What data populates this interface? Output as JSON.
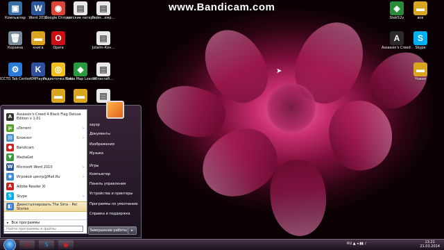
{
  "watermark": "www.Bandicam.com",
  "desktop_icons": [
    {
      "label": "Компьютер",
      "icon": "computer-icon",
      "color": "#3a6ea5",
      "glyph": "▣"
    },
    {
      "label": "Word 2010",
      "icon": "word-icon",
      "color": "#2b579a",
      "glyph": "W"
    },
    {
      "label": "Google Chrome",
      "icon": "chrome-icon",
      "color": "#db4437",
      "glyph": "◉"
    },
    {
      "label": "детские лагеря",
      "icon": "document-icon",
      "color": "#e8e8e8",
      "glyph": "▤"
    },
    {
      "label": "Гейм...емр...",
      "icon": "document-icon",
      "color": "#e8e8e8",
      "glyph": "▤"
    },
    {
      "label": "Корзина",
      "icon": "recycle-bin-icon",
      "color": "#7a8a9a",
      "glyph": "🗑"
    },
    {
      "label": "книга",
      "icon": "folder-icon",
      "color": "#d9a520",
      "glyph": "▬"
    },
    {
      "label": "Opera",
      "icon": "opera-icon",
      "color": "#cc0f16",
      "glyph": "O"
    },
    {
      "label": "Jotaim-Кон...",
      "icon": "document-icon",
      "color": "#e8e8e8",
      "glyph": "▤"
    },
    {
      "label": "ICCTO Tab Center",
      "icon": "tool-icon",
      "color": "#2a7ad8",
      "glyph": "⚙"
    },
    {
      "label": "KMPlayer",
      "icon": "kmplayer-icon",
      "color": "#3050a0",
      "glyph": "K"
    },
    {
      "label": "Радиоточка Плюс",
      "icon": "radio-icon",
      "color": "#f0c020",
      "glyph": "◎"
    },
    {
      "label": "Nokia Map Loader",
      "icon": "map-icon",
      "color": "#2a9a40",
      "glyph": "◆"
    },
    {
      "label": "Minecraft...",
      "icon": "document-icon",
      "color": "#e8e8e8",
      "glyph": "▤"
    },
    {
      "label": "",
      "icon": "folder-icon",
      "color": "#d9a520",
      "glyph": "▬"
    },
    {
      "label": "",
      "icon": "folder-icon",
      "color": "#d9a520",
      "glyph": "▬"
    },
    {
      "label": "Stek52v",
      "icon": "game-icon",
      "color": "#2a8a3a",
      "glyph": "◈"
    },
    {
      "label": "все",
      "icon": "folder-icon",
      "color": "#d9a520",
      "glyph": "▬"
    },
    {
      "label": "Assassin's Creed 4 Bla...",
      "icon": "assassins-creed-icon",
      "color": "#2a2a2a",
      "glyph": "A"
    },
    {
      "label": "Skype",
      "icon": "skype-icon",
      "color": "#00aff0",
      "glyph": "S"
    },
    {
      "label": "",
      "icon": "document-icon",
      "color": "#e8e8e8",
      "glyph": "▤"
    },
    {
      "label": "Новая",
      "icon": "folder-icon",
      "color": "#d9a520",
      "glyph": "▬"
    }
  ],
  "start_menu": {
    "programs": [
      {
        "label": "Assassin's Creed 4 Black Flag Deluxe Edition v 1.01",
        "icon": "assassins-creed-icon",
        "color": "#333333",
        "glyph": "A",
        "arrow": ""
      },
      {
        "label": "uTorrent",
        "icon": "utorrent-icon",
        "color": "#5aa02c",
        "glyph": "µ",
        "arrow": "›"
      },
      {
        "label": "Блокнот",
        "icon": "notepad-icon",
        "color": "#4a90d0",
        "glyph": "▤",
        "arrow": "›"
      },
      {
        "label": "Bandicam",
        "icon": "bandicam-icon",
        "color": "#d02020",
        "glyph": "●",
        "arrow": ""
      },
      {
        "label": "MediaGet",
        "icon": "mediaget-icon",
        "color": "#3a9a3a",
        "glyph": "▼",
        "arrow": ""
      },
      {
        "label": "Microsoft Word 2010",
        "icon": "word-icon",
        "color": "#2b579a",
        "glyph": "W",
        "arrow": "›"
      },
      {
        "label": "Игровой центр@Mail.Ru",
        "icon": "game-center-icon",
        "color": "#3a8ad8",
        "glyph": "◉",
        "arrow": "›"
      },
      {
        "label": "Adobe Reader XI",
        "icon": "adobe-reader-icon",
        "color": "#c81e1e",
        "glyph": "A",
        "arrow": ""
      },
      {
        "label": "Skype",
        "icon": "skype-icon",
        "color": "#00aff0",
        "glyph": "S",
        "arrow": "›"
      },
      {
        "label": "Деинсталлировать The Sims - Pet Stories",
        "icon": "uninstall-icon",
        "color": "#3a7ad0",
        "glyph": "◧",
        "arrow": ""
      }
    ],
    "all_programs": "Все программы",
    "search_placeholder": "Найти программы и файлы",
    "right_items": [
      "sayop",
      "Документы",
      "Изображения",
      "Музыка",
      "Игры",
      "Компьютер",
      "Панель управления",
      "Устройства и принтеры",
      "Программы по умолчанию",
      "Справка и поддержка"
    ],
    "shutdown": "Завершение работы",
    "shutdown_arrow": "▸"
  },
  "taskbar": {
    "buttons": [
      {
        "icon": "opera-icon",
        "color": "#cc0f16",
        "glyph": "O"
      },
      {
        "icon": "skype-icon",
        "color": "#00aff0",
        "glyph": "S"
      },
      {
        "icon": "bandicam-icon",
        "color": "#d02020",
        "glyph": "●"
      }
    ],
    "tray": "RU ▲ ◂ ▮▮ ♪",
    "time": "13:21",
    "date": "21.03.2014"
  }
}
